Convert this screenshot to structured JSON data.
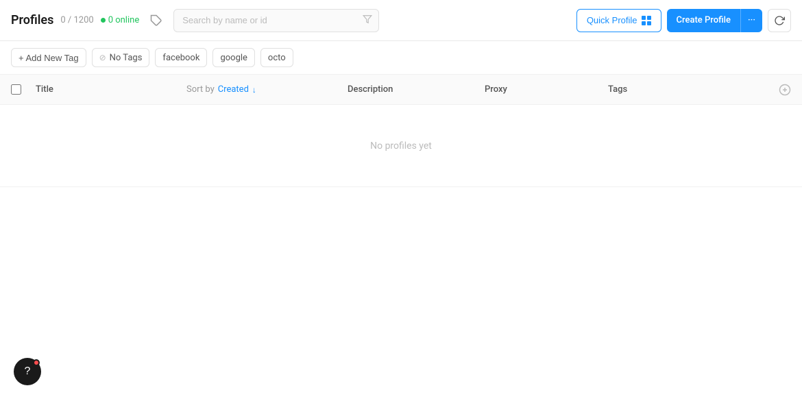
{
  "header": {
    "title": "Profiles",
    "count": "0 / 1200",
    "online_count": "0 online",
    "search_placeholder": "Search by name or id",
    "quick_profile_label": "Quick Profile",
    "create_profile_label": "Create Profile",
    "more_dots": "···"
  },
  "tags_row": {
    "add_tag_label": "+ Add New Tag",
    "tags": [
      {
        "label": "No Tags",
        "has_icon": true
      },
      {
        "label": "facebook",
        "has_icon": false
      },
      {
        "label": "google",
        "has_icon": false
      },
      {
        "label": "octo",
        "has_icon": false
      }
    ]
  },
  "table": {
    "columns": {
      "title": "Title",
      "sort_prefix": "Sort by",
      "sort_field": "Created",
      "description": "Description",
      "proxy": "Proxy",
      "tags": "Tags"
    },
    "empty_message": "No profiles yet"
  }
}
